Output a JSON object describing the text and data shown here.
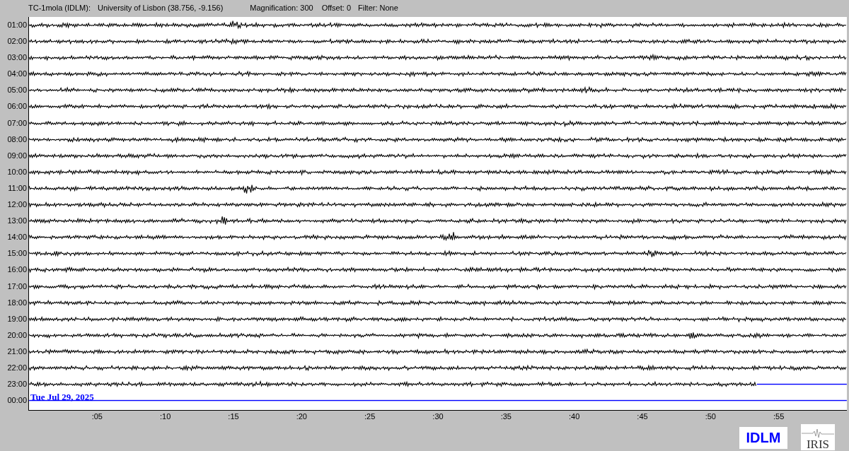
{
  "header": {
    "station": "TC-1mola (IDLM):",
    "location": "University of Lisbon (38.756, -9.156)",
    "magnification": "Magnification: 300",
    "offset": "Offset: 0",
    "filter": "Filter: None"
  },
  "rows": [
    {
      "time": "01:00",
      "level": 1
    },
    {
      "time": "02:00",
      "level": 1
    },
    {
      "time": "03:00",
      "level": 1
    },
    {
      "time": "04:00",
      "level": 1
    },
    {
      "time": "05:00",
      "level": 1
    },
    {
      "time": "06:00",
      "level": 1
    },
    {
      "time": "07:00",
      "level": 1
    },
    {
      "time": "08:00",
      "level": 1
    },
    {
      "time": "09:00",
      "level": 1
    },
    {
      "time": "10:00",
      "level": 1
    },
    {
      "time": "11:00",
      "level": 1
    },
    {
      "time": "12:00",
      "level": 1
    },
    {
      "time": "13:00",
      "level": 1
    },
    {
      "time": "14:00",
      "level": 1
    },
    {
      "time": "15:00",
      "level": 1
    },
    {
      "time": "16:00",
      "level": 1
    },
    {
      "time": "17:00",
      "level": 1
    },
    {
      "time": "18:00",
      "level": 1
    },
    {
      "time": "19:00",
      "level": 1
    },
    {
      "time": "20:00",
      "level": 1
    },
    {
      "time": "21:00",
      "level": 1
    },
    {
      "time": "22:00",
      "level": 1
    },
    {
      "time": "23:00",
      "level": 0.89
    },
    {
      "time": "00:00",
      "level": 0
    }
  ],
  "date": "Tue Jul 29, 2025",
  "x_ticks": [
    ":05",
    ":10",
    ":15",
    ":20",
    ":25",
    ":30",
    ":35",
    ":40",
    ":45",
    ":50",
    ":55"
  ],
  "logos": {
    "network": "IDLM",
    "iris": "IRIS"
  }
}
